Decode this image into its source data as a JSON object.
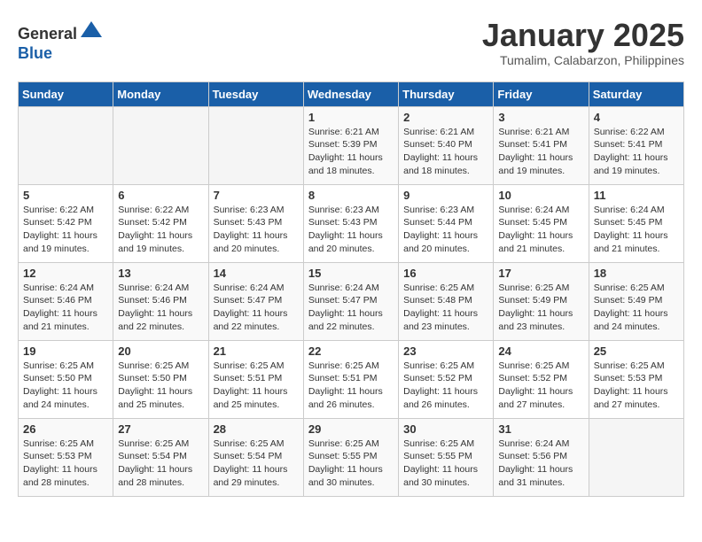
{
  "header": {
    "logo": {
      "line1": "General",
      "line2": "Blue"
    },
    "title": "January 2025",
    "location": "Tumalim, Calabarzon, Philippines"
  },
  "weekdays": [
    "Sunday",
    "Monday",
    "Tuesday",
    "Wednesday",
    "Thursday",
    "Friday",
    "Saturday"
  ],
  "weeks": [
    [
      {
        "day": "",
        "info": ""
      },
      {
        "day": "",
        "info": ""
      },
      {
        "day": "",
        "info": ""
      },
      {
        "day": "1",
        "sunrise": "6:21 AM",
        "sunset": "5:39 PM",
        "daylight": "11 hours and 18 minutes."
      },
      {
        "day": "2",
        "sunrise": "6:21 AM",
        "sunset": "5:40 PM",
        "daylight": "11 hours and 18 minutes."
      },
      {
        "day": "3",
        "sunrise": "6:21 AM",
        "sunset": "5:41 PM",
        "daylight": "11 hours and 19 minutes."
      },
      {
        "day": "4",
        "sunrise": "6:22 AM",
        "sunset": "5:41 PM",
        "daylight": "11 hours and 19 minutes."
      }
    ],
    [
      {
        "day": "5",
        "sunrise": "6:22 AM",
        "sunset": "5:42 PM",
        "daylight": "11 hours and 19 minutes."
      },
      {
        "day": "6",
        "sunrise": "6:22 AM",
        "sunset": "5:42 PM",
        "daylight": "11 hours and 19 minutes."
      },
      {
        "day": "7",
        "sunrise": "6:23 AM",
        "sunset": "5:43 PM",
        "daylight": "11 hours and 20 minutes."
      },
      {
        "day": "8",
        "sunrise": "6:23 AM",
        "sunset": "5:43 PM",
        "daylight": "11 hours and 20 minutes."
      },
      {
        "day": "9",
        "sunrise": "6:23 AM",
        "sunset": "5:44 PM",
        "daylight": "11 hours and 20 minutes."
      },
      {
        "day": "10",
        "sunrise": "6:24 AM",
        "sunset": "5:45 PM",
        "daylight": "11 hours and 21 minutes."
      },
      {
        "day": "11",
        "sunrise": "6:24 AM",
        "sunset": "5:45 PM",
        "daylight": "11 hours and 21 minutes."
      }
    ],
    [
      {
        "day": "12",
        "sunrise": "6:24 AM",
        "sunset": "5:46 PM",
        "daylight": "11 hours and 21 minutes."
      },
      {
        "day": "13",
        "sunrise": "6:24 AM",
        "sunset": "5:46 PM",
        "daylight": "11 hours and 22 minutes."
      },
      {
        "day": "14",
        "sunrise": "6:24 AM",
        "sunset": "5:47 PM",
        "daylight": "11 hours and 22 minutes."
      },
      {
        "day": "15",
        "sunrise": "6:24 AM",
        "sunset": "5:47 PM",
        "daylight": "11 hours and 22 minutes."
      },
      {
        "day": "16",
        "sunrise": "6:25 AM",
        "sunset": "5:48 PM",
        "daylight": "11 hours and 23 minutes."
      },
      {
        "day": "17",
        "sunrise": "6:25 AM",
        "sunset": "5:49 PM",
        "daylight": "11 hours and 23 minutes."
      },
      {
        "day": "18",
        "sunrise": "6:25 AM",
        "sunset": "5:49 PM",
        "daylight": "11 hours and 24 minutes."
      }
    ],
    [
      {
        "day": "19",
        "sunrise": "6:25 AM",
        "sunset": "5:50 PM",
        "daylight": "11 hours and 24 minutes."
      },
      {
        "day": "20",
        "sunrise": "6:25 AM",
        "sunset": "5:50 PM",
        "daylight": "11 hours and 25 minutes."
      },
      {
        "day": "21",
        "sunrise": "6:25 AM",
        "sunset": "5:51 PM",
        "daylight": "11 hours and 25 minutes."
      },
      {
        "day": "22",
        "sunrise": "6:25 AM",
        "sunset": "5:51 PM",
        "daylight": "11 hours and 26 minutes."
      },
      {
        "day": "23",
        "sunrise": "6:25 AM",
        "sunset": "5:52 PM",
        "daylight": "11 hours and 26 minutes."
      },
      {
        "day": "24",
        "sunrise": "6:25 AM",
        "sunset": "5:52 PM",
        "daylight": "11 hours and 27 minutes."
      },
      {
        "day": "25",
        "sunrise": "6:25 AM",
        "sunset": "5:53 PM",
        "daylight": "11 hours and 27 minutes."
      }
    ],
    [
      {
        "day": "26",
        "sunrise": "6:25 AM",
        "sunset": "5:53 PM",
        "daylight": "11 hours and 28 minutes."
      },
      {
        "day": "27",
        "sunrise": "6:25 AM",
        "sunset": "5:54 PM",
        "daylight": "11 hours and 28 minutes."
      },
      {
        "day": "28",
        "sunrise": "6:25 AM",
        "sunset": "5:54 PM",
        "daylight": "11 hours and 29 minutes."
      },
      {
        "day": "29",
        "sunrise": "6:25 AM",
        "sunset": "5:55 PM",
        "daylight": "11 hours and 30 minutes."
      },
      {
        "day": "30",
        "sunrise": "6:25 AM",
        "sunset": "5:55 PM",
        "daylight": "11 hours and 30 minutes."
      },
      {
        "day": "31",
        "sunrise": "6:24 AM",
        "sunset": "5:56 PM",
        "daylight": "11 hours and 31 minutes."
      },
      {
        "day": "",
        "info": ""
      }
    ]
  ]
}
